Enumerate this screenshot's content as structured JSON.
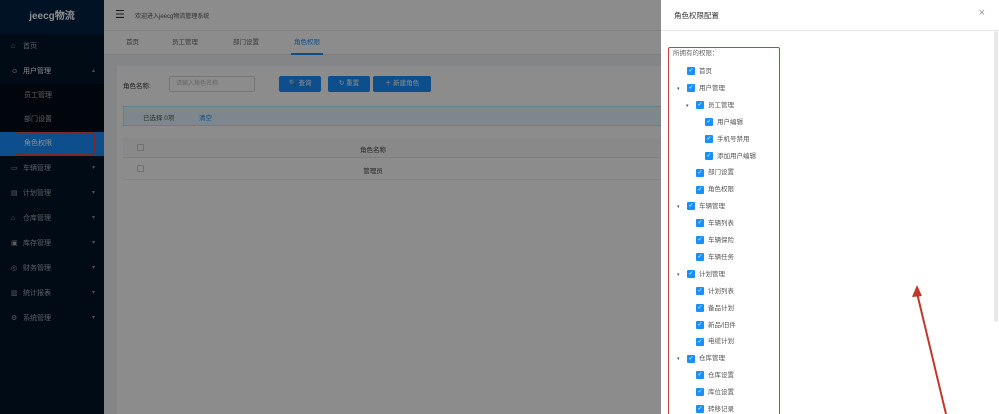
{
  "sidebar": {
    "logo": "jeecg物流",
    "items": [
      {
        "label": "首页",
        "icon": "home-icon",
        "glyph": "⌂",
        "has_arrow": false
      },
      {
        "label": "用户管理",
        "icon": "user-icon",
        "glyph": "☺",
        "has_arrow": true,
        "arrow": "▴",
        "open": true,
        "children": [
          {
            "label": "员工管理"
          },
          {
            "label": "部门设置"
          },
          {
            "label": "角色权限",
            "active": true
          }
        ]
      },
      {
        "label": "车辆管理",
        "icon": "car-icon",
        "glyph": "▭",
        "has_arrow": true,
        "arrow": "▾"
      },
      {
        "label": "计划管理",
        "icon": "plan-icon",
        "glyph": "▤",
        "has_arrow": true,
        "arrow": "▾"
      },
      {
        "label": "仓库管理",
        "icon": "warehouse-icon",
        "glyph": "⌂",
        "has_arrow": true,
        "arrow": "▾"
      },
      {
        "label": "库存管理",
        "icon": "inventory-icon",
        "glyph": "▣",
        "has_arrow": true,
        "arrow": "▾"
      },
      {
        "label": "财务管理",
        "icon": "finance-icon",
        "glyph": "◎",
        "has_arrow": true,
        "arrow": "▾"
      },
      {
        "label": "统计报表",
        "icon": "stats-icon",
        "glyph": "▥",
        "has_arrow": true,
        "arrow": "▾"
      },
      {
        "label": "系统管理",
        "icon": "settings-icon",
        "glyph": "⚙",
        "has_arrow": true,
        "arrow": "▾"
      }
    ]
  },
  "header": {
    "menu_icon": "☰",
    "welcome": "欢迎进入jeecg物流管理系统"
  },
  "tabs": [
    {
      "label": "首页"
    },
    {
      "label": "员工管理"
    },
    {
      "label": "部门设置"
    },
    {
      "label": "角色权限",
      "active": true
    }
  ],
  "main": {
    "search_label": "角色名称:",
    "search_placeholder": "请输入角色名称",
    "query_button": "🔍 查询",
    "reset_button": "↻ 重置",
    "new_button": "＋ 新建角色",
    "selected_text": "已选择 0项",
    "clear_text": "清空",
    "column_header": "角色名称",
    "rows": [
      "管理员"
    ]
  },
  "drawer": {
    "title": "角色权限配置",
    "close": "×",
    "tree_title": "所拥有的权限：",
    "nodes": [
      {
        "label": "首页",
        "level": 0,
        "toggle": ""
      },
      {
        "label": "用户管理",
        "level": 0,
        "toggle": "▾"
      },
      {
        "label": "员工管理",
        "level": 1,
        "toggle": "▾"
      },
      {
        "label": "用户编辑",
        "level": 2,
        "toggle": ""
      },
      {
        "label": "手机号禁用",
        "level": 2,
        "toggle": ""
      },
      {
        "label": "添加用户编辑",
        "level": 2,
        "toggle": ""
      },
      {
        "label": "部门设置",
        "level": 1,
        "toggle": ""
      },
      {
        "label": "角色权限",
        "level": 1,
        "toggle": ""
      },
      {
        "label": "车辆管理",
        "level": 0,
        "toggle": "▾"
      },
      {
        "label": "车辆列表",
        "level": 1,
        "toggle": ""
      },
      {
        "label": "车辆保险",
        "level": 1,
        "toggle": ""
      },
      {
        "label": "车辆任务",
        "level": 1,
        "toggle": ""
      },
      {
        "label": "计划管理",
        "level": 0,
        "toggle": "▾"
      },
      {
        "label": "计划列表",
        "level": 1,
        "toggle": ""
      },
      {
        "label": "备品计划",
        "level": 1,
        "toggle": ""
      },
      {
        "label": "新品/旧件",
        "level": 1,
        "toggle": ""
      },
      {
        "label": "电缆计划",
        "level": 1,
        "toggle": ""
      },
      {
        "label": "仓库管理",
        "level": 0,
        "toggle": "▾"
      },
      {
        "label": "仓库设置",
        "level": 1,
        "toggle": ""
      },
      {
        "label": "库位设置",
        "level": 1,
        "toggle": ""
      },
      {
        "label": "转移记录",
        "level": 1,
        "toggle": ""
      }
    ]
  }
}
